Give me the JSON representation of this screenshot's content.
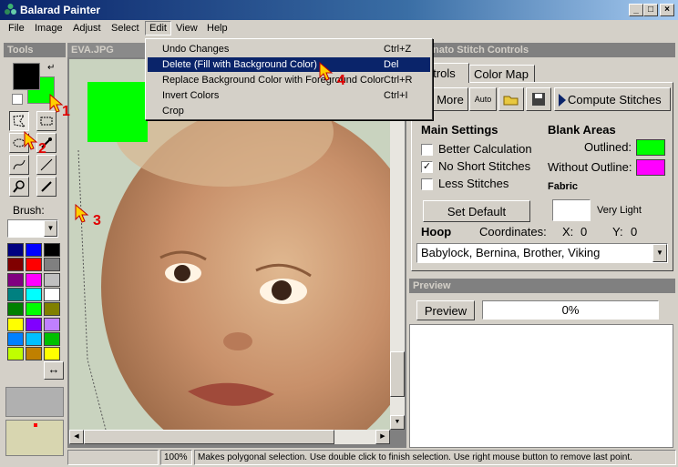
{
  "window": {
    "title": "Balarad Painter"
  },
  "menubar": [
    "File",
    "Image",
    "Adjust",
    "Select",
    "Edit",
    "View",
    "Help"
  ],
  "edit_menu": [
    {
      "label": "Undo Changes",
      "shortcut": "Ctrl+Z"
    },
    {
      "label": "Delete  (Fill with Background Color)",
      "shortcut": "Del"
    },
    {
      "label": "Replace Background Color with Foreground Color",
      "shortcut": "Ctrl+R"
    },
    {
      "label": "Invert Colors",
      "shortcut": "Ctrl+I"
    },
    {
      "label": "Crop",
      "shortcut": ""
    }
  ],
  "tools": {
    "header": "Tools",
    "brush_label": "Brush:",
    "foreground_color": "#000000",
    "background_color": "#00ff00",
    "palette": [
      "#000080",
      "#0000ff",
      "#000000",
      "#800000",
      "#ff0000",
      "#808080",
      "#800080",
      "#ff00ff",
      "#c0c0c0",
      "#008080",
      "#00ffff",
      "#ffffff",
      "#008000",
      "#00ff00",
      "#808000",
      "#ffff00",
      "#8000ff",
      "#c080ff",
      "#0080ff",
      "#00c0ff",
      "#00c000",
      "#c0ff00",
      "#c08000",
      "#ffff00"
    ]
  },
  "image_window": {
    "title": "EVA.JPG"
  },
  "stitch": {
    "header": "nato Stitch Controls",
    "tabs": [
      "ntrols",
      "Color Map"
    ],
    "toolbar": {
      "more": "More",
      "auto": "Auto",
      "compute": "Compute Stitches"
    },
    "main_settings": "Main Settings",
    "options": [
      {
        "label": "Better Calculation",
        "checked": false
      },
      {
        "label": "No Short Stitches",
        "checked": true
      },
      {
        "label": "Less Stitches",
        "checked": false
      }
    ],
    "set_default": "Set Default",
    "blank_areas": "Blank Areas",
    "outlined_label": "Outlined:",
    "outlined_color": "#00ff00",
    "without_outline_label": "Without Outline:",
    "without_outline_color": "#ff00ff",
    "fabric_label": "Fabric",
    "fabric_value": "Very Light",
    "hoop_label": "Hoop",
    "coordinates_label": "Coordinates:",
    "x_label": "X:",
    "x_value": "0",
    "y_label": "Y:",
    "y_value": "0",
    "hoop_value": "Babylock, Bernina, Brother, Viking"
  },
  "preview": {
    "header": "Preview",
    "button": "Preview",
    "progress": "0%"
  },
  "status": {
    "zoom": "100%",
    "message": "Makes polygonal selection. Use double click to finish selection. Use right mouse button to remove last point."
  },
  "annotations": [
    "1",
    "2",
    "3",
    "4"
  ]
}
